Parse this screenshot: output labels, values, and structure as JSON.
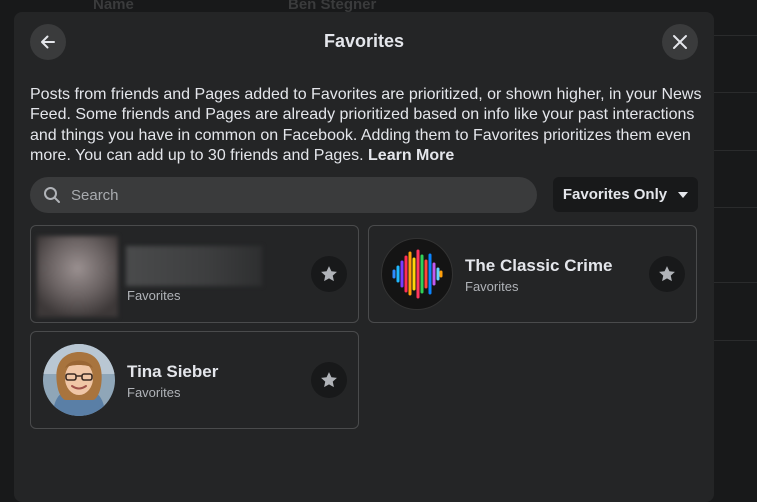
{
  "background": {
    "columns": [
      "Name",
      "Ben Stegner"
    ]
  },
  "modal": {
    "title": "Favorites",
    "back_icon": "arrow-left-icon",
    "close_icon": "close-icon",
    "description": "Posts from friends and Pages added to Favorites are prioritized, or shown higher, in your News Feed. Some friends and Pages are already prioritized based on info like your past interactions and things you have in common on Facebook. Adding them to Favorites prioritizes them even more. You can add up to 30 friends and Pages.",
    "learn_more": "Learn More",
    "search": {
      "placeholder": "Search",
      "value": ""
    },
    "filter": {
      "label": "Favorites Only"
    },
    "items": [
      {
        "name": "",
        "subtitle": "Favorites",
        "blurred": true
      },
      {
        "name": "The Classic Crime",
        "subtitle": "Favorites"
      },
      {
        "name": "Tina Sieber",
        "subtitle": "Favorites"
      }
    ]
  },
  "colors": {
    "background": "#18191a",
    "modal": "#242526",
    "button": "#3a3b3c",
    "text": "#e4e6eb",
    "secondary_text": "#b0b3b8"
  }
}
